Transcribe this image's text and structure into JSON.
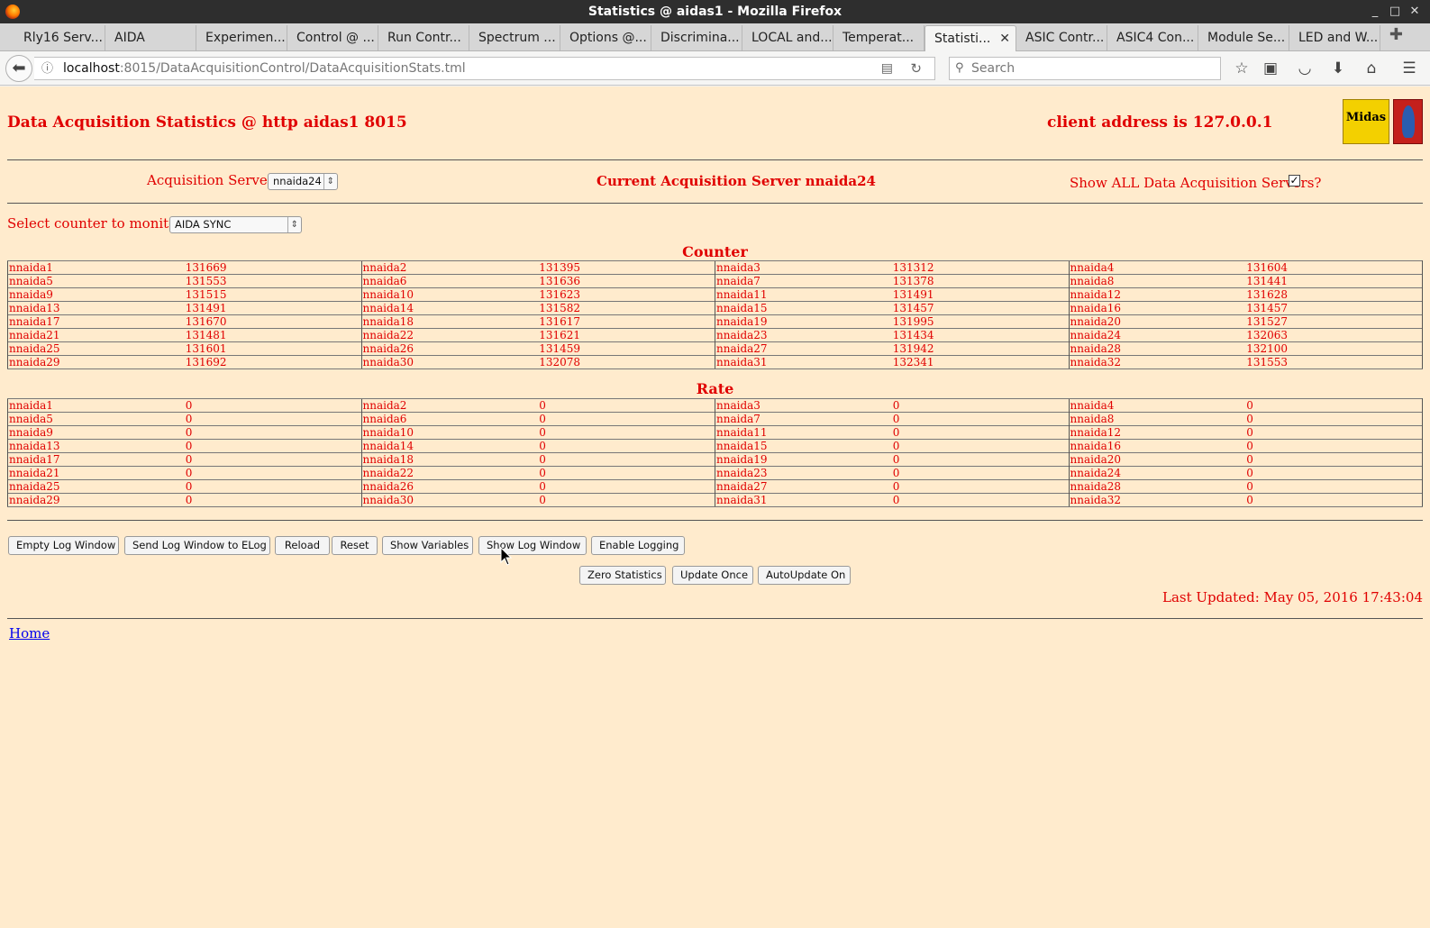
{
  "window": {
    "title": "Statistics @ aidas1 - Mozilla Firefox",
    "controls": [
      "_",
      "□",
      "✕"
    ]
  },
  "tabs": [
    {
      "label": "Rly16 Serv..."
    },
    {
      "label": "AIDA"
    },
    {
      "label": "Experimen..."
    },
    {
      "label": "Control @ ..."
    },
    {
      "label": "Run Contr..."
    },
    {
      "label": "Spectrum ..."
    },
    {
      "label": "Options @..."
    },
    {
      "label": "Discrimina..."
    },
    {
      "label": "LOCAL and..."
    },
    {
      "label": "Temperat..."
    },
    {
      "label": "Statisti...",
      "active": true
    },
    {
      "label": "ASIC Contr..."
    },
    {
      "label": "ASIC4 Con..."
    },
    {
      "label": "Module Se..."
    },
    {
      "label": "LED and W..."
    }
  ],
  "navbar": {
    "url_host": "localhost",
    "url_rest": ":8015/DataAcquisitionControl/DataAcquisitionStats.tml",
    "search_placeholder": "Search"
  },
  "page": {
    "title": "Data Acquisition Statistics @ http aidas1 8015",
    "client_address": "client address is 127.0.0.1",
    "logo_text": "Midas",
    "acq_servers_label": "Acquisition Servers",
    "acq_servers_selected": "nnaida24",
    "current_server": "Current Acquisition Server nnaida24",
    "show_all_label": "Show ALL Data Acquisition Servers?",
    "show_all_checked": true,
    "counter_select_label": "Select counter to monitor",
    "counter_select_value": "AIDA SYNC",
    "counter_title": "Counter",
    "rate_title": "Rate",
    "counter_rows": [
      [
        [
          "nnaida1",
          "131669"
        ],
        [
          "nnaida2",
          "131395"
        ],
        [
          "nnaida3",
          "131312"
        ],
        [
          "nnaida4",
          "131604"
        ]
      ],
      [
        [
          "nnaida5",
          "131553"
        ],
        [
          "nnaida6",
          "131636"
        ],
        [
          "nnaida7",
          "131378"
        ],
        [
          "nnaida8",
          "131441"
        ]
      ],
      [
        [
          "nnaida9",
          "131515"
        ],
        [
          "nnaida10",
          "131623"
        ],
        [
          "nnaida11",
          "131491"
        ],
        [
          "nnaida12",
          "131628"
        ]
      ],
      [
        [
          "nnaida13",
          "131491"
        ],
        [
          "nnaida14",
          "131582"
        ],
        [
          "nnaida15",
          "131457"
        ],
        [
          "nnaida16",
          "131457"
        ]
      ],
      [
        [
          "nnaida17",
          "131670"
        ],
        [
          "nnaida18",
          "131617"
        ],
        [
          "nnaida19",
          "131995"
        ],
        [
          "nnaida20",
          "131527"
        ]
      ],
      [
        [
          "nnaida21",
          "131481"
        ],
        [
          "nnaida22",
          "131621"
        ],
        [
          "nnaida23",
          "131434"
        ],
        [
          "nnaida24",
          "132063"
        ]
      ],
      [
        [
          "nnaida25",
          "131601"
        ],
        [
          "nnaida26",
          "131459"
        ],
        [
          "nnaida27",
          "131942"
        ],
        [
          "nnaida28",
          "132100"
        ]
      ],
      [
        [
          "nnaida29",
          "131692"
        ],
        [
          "nnaida30",
          "132078"
        ],
        [
          "nnaida31",
          "132341"
        ],
        [
          "nnaida32",
          "131553"
        ]
      ]
    ],
    "rate_rows": [
      [
        [
          "nnaida1",
          "0"
        ],
        [
          "nnaida2",
          "0"
        ],
        [
          "nnaida3",
          "0"
        ],
        [
          "nnaida4",
          "0"
        ]
      ],
      [
        [
          "nnaida5",
          "0"
        ],
        [
          "nnaida6",
          "0"
        ],
        [
          "nnaida7",
          "0"
        ],
        [
          "nnaida8",
          "0"
        ]
      ],
      [
        [
          "nnaida9",
          "0"
        ],
        [
          "nnaida10",
          "0"
        ],
        [
          "nnaida11",
          "0"
        ],
        [
          "nnaida12",
          "0"
        ]
      ],
      [
        [
          "nnaida13",
          "0"
        ],
        [
          "nnaida14",
          "0"
        ],
        [
          "nnaida15",
          "0"
        ],
        [
          "nnaida16",
          "0"
        ]
      ],
      [
        [
          "nnaida17",
          "0"
        ],
        [
          "nnaida18",
          "0"
        ],
        [
          "nnaida19",
          "0"
        ],
        [
          "nnaida20",
          "0"
        ]
      ],
      [
        [
          "nnaida21",
          "0"
        ],
        [
          "nnaida22",
          "0"
        ],
        [
          "nnaida23",
          "0"
        ],
        [
          "nnaida24",
          "0"
        ]
      ],
      [
        [
          "nnaida25",
          "0"
        ],
        [
          "nnaida26",
          "0"
        ],
        [
          "nnaida27",
          "0"
        ],
        [
          "nnaida28",
          "0"
        ]
      ],
      [
        [
          "nnaida29",
          "0"
        ],
        [
          "nnaida30",
          "0"
        ],
        [
          "nnaida31",
          "0"
        ],
        [
          "nnaida32",
          "0"
        ]
      ]
    ],
    "buttons_row1": {
      "empty_log": "Empty Log Window",
      "send_log": "Send Log Window to ELog",
      "reload": "Reload",
      "reset": "Reset",
      "show_variables": "Show Variables",
      "show_log": "Show Log Window",
      "enable_logging": "Enable Logging"
    },
    "buttons_row2": {
      "zero_stats": "Zero Statistics",
      "update_once": "Update Once",
      "autoupdate": "AutoUpdate On"
    },
    "last_updated": "Last Updated: May 05, 2016 17:43:04",
    "home_link": "Home"
  },
  "colors": {
    "page_bg": "#ffebcd",
    "text_red": "#e00000",
    "link_blue": "#0000ee"
  }
}
